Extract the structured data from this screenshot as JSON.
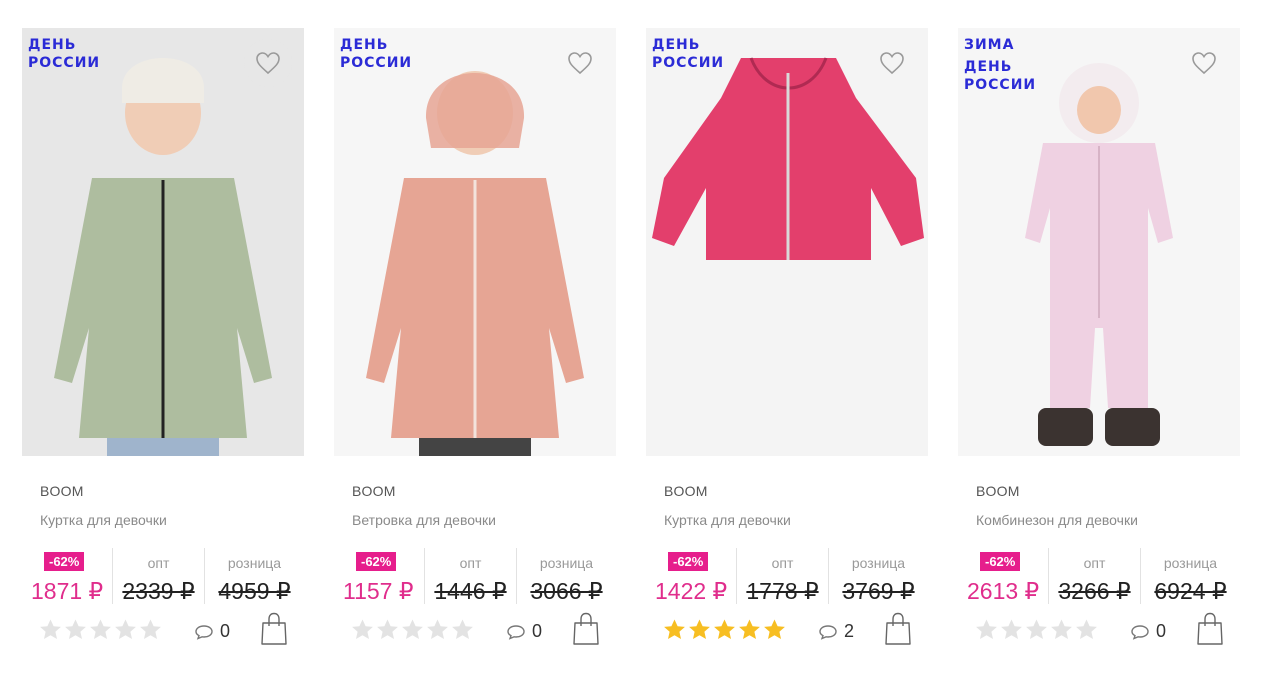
{
  "products": [
    {
      "badges": [
        "ДЕНЬ",
        "РОССИИ"
      ],
      "favorite_highlighted": true,
      "brand": "BOOM",
      "name": "Куртка для девочки",
      "discount": "-62%",
      "opt_label": "опт",
      "retail_label": "розница",
      "price": "1871 ₽",
      "opt_price": "2339 ₽",
      "retail_price": "4959 ₽",
      "rating": 0,
      "comments": "0",
      "photo_bg": "#e7e7e7",
      "garment_color": "#aebd9f"
    },
    {
      "badges": [
        "ДЕНЬ",
        "РОССИИ"
      ],
      "favorite_highlighted": false,
      "brand": "BOOM",
      "name": "Ветровка для девочки",
      "discount": "-62%",
      "opt_label": "опт",
      "retail_label": "розница",
      "price": "1157 ₽",
      "opt_price": "1446 ₽",
      "retail_price": "3066 ₽",
      "rating": 0,
      "comments": "0",
      "photo_bg": "#f6f6f6",
      "garment_color": "#e6a594"
    },
    {
      "badges": [
        "ДЕНЬ",
        "РОССИИ"
      ],
      "favorite_highlighted": false,
      "brand": "BOOM",
      "name": "Куртка для девочки",
      "discount": "-62%",
      "opt_label": "опт",
      "retail_label": "розница",
      "price": "1422 ₽",
      "opt_price": "1778 ₽",
      "retail_price": "3769 ₽",
      "rating": 5,
      "comments": "2",
      "photo_bg": "#f4f4f4",
      "garment_color": "#e33f6c"
    },
    {
      "badges": [
        "ЗИМА",
        "ДЕНЬ",
        "РОССИИ"
      ],
      "favorite_highlighted": false,
      "brand": "BOOM",
      "name": "Комбинезон для девочки",
      "discount": "-62%",
      "opt_label": "опт",
      "retail_label": "розница",
      "price": "2613 ₽",
      "opt_price": "3266 ₽",
      "retail_price": "6924 ₽",
      "rating": 0,
      "comments": "0",
      "photo_bg": "#f6f6f6",
      "garment_color": "#efd1e2"
    }
  ],
  "colors": {
    "badge": "#2b2bd6",
    "discount_bg": "#e61e8c",
    "price": "#e02d8c",
    "star_on": "#f7be22",
    "star_off": "#e3e3e3"
  }
}
